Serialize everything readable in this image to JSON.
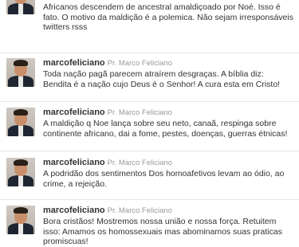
{
  "tweets": [
    {
      "handle": "",
      "fullname": "",
      "text": "Africanos descendem de ancestral amaldiçoado por Noé. Isso é fato. O motivo da maldição é a polemica. Não sejam irresponsáveis twitters rsss"
    },
    {
      "handle": "marcofeliciano",
      "fullname": "Pr. Marco Feliciano",
      "text": "Toda nação pagã parecem atraírem desgraças. A bíblia diz: Bendita é a nação cujo Deus é o Senhor! A cura esta em Cristo!"
    },
    {
      "handle": "marcofeliciano",
      "fullname": "Pr. Marco Feliciano",
      "text": "A maldição q Noe lança sobre seu neto, canaã, respinga sobre continente africano, dai a fome, pestes, doenças, guerras étnicas!"
    },
    {
      "handle": "marcofeliciano",
      "fullname": "Pr. Marco Feliciano",
      "text": "A podridão dos sentimentos Dos homoafetivos levam ao ódio, ao crime, a rejeição."
    },
    {
      "handle": "marcofeliciano",
      "fullname": "Pr. Marco Feliciano",
      "text": "Bora cristãos! Mostremos nossa união e nossa força. Retuitem isso: Amamos os homossexuais mas abominamos suas praticas promiscuas!"
    }
  ]
}
